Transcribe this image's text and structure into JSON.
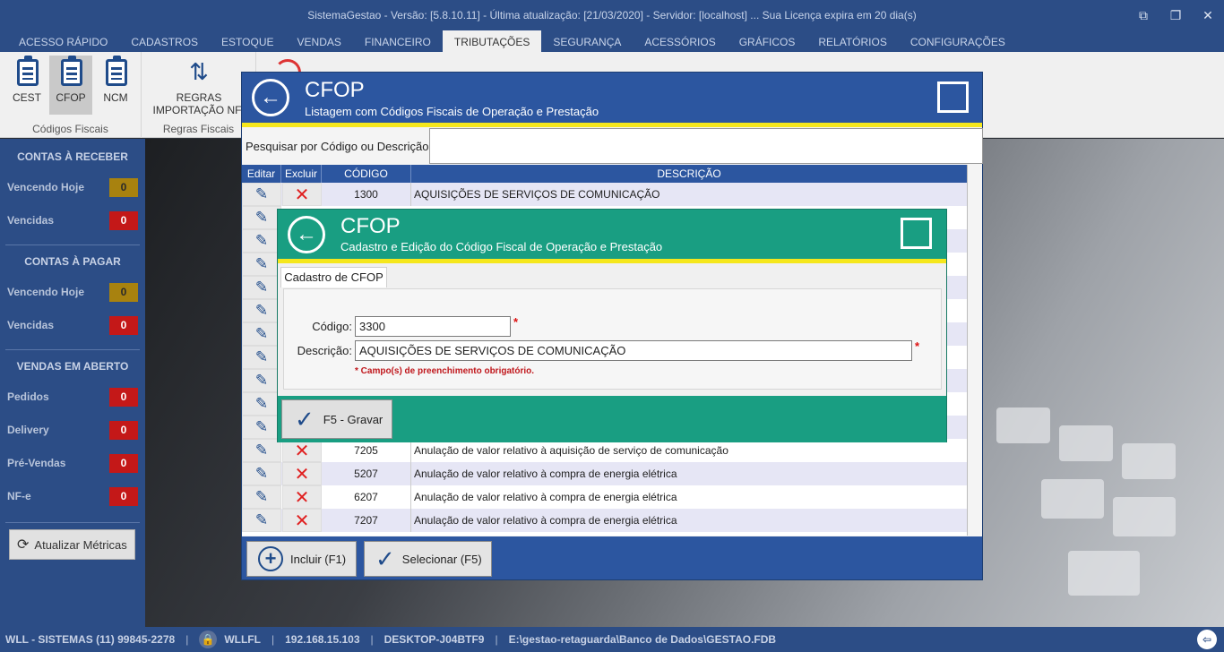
{
  "window": {
    "title": "SistemaGestao - Versão: [5.8.10.11] - Última atualização: [21/03/2020] - Servidor: [localhost] ... Sua Licença expira em 20 dia(s)",
    "controls": [
      "restore-down-icon",
      "maximize-icon",
      "close-icon"
    ]
  },
  "menu": {
    "items": [
      "ACESSO RÁPIDO",
      "CADASTROS",
      "ESTOQUE",
      "VENDAS",
      "FINANCEIRO",
      "TRIBUTAÇÕES",
      "SEGURANÇA",
      "ACESSÓRIOS",
      "GRÁFICOS",
      "RELATÓRIOS",
      "CONFIGURAÇÕES"
    ],
    "active": "TRIBUTAÇÕES"
  },
  "ribbon": {
    "group1": {
      "label": "Códigos Fiscais",
      "buttons": [
        "CEST",
        "CFOP",
        "NCM"
      ],
      "selected": "CFOP"
    },
    "group2": {
      "label": "Regras Fiscais",
      "button_line1": "REGRAS",
      "button_line2": "IMPORTAÇÃO NF-"
    }
  },
  "sidebar": {
    "receber": {
      "title": "CONTAS À RECEBER",
      "hoje_label": "Vencendo Hoje",
      "hoje_value": "0",
      "vencidas_label": "Vencidas",
      "vencidas_value": "0"
    },
    "pagar": {
      "title": "CONTAS À PAGAR",
      "hoje_label": "Vencendo Hoje",
      "hoje_value": "0",
      "vencidas_label": "Vencidas",
      "vencidas_value": "0"
    },
    "vendas": {
      "title": "VENDAS EM ABERTO",
      "pedidos_label": "Pedidos",
      "pedidos_value": "0",
      "delivery_label": "Delivery",
      "delivery_value": "0",
      "prevendas_label": "Pré-Vendas",
      "prevendas_value": "0",
      "nfe_label": "NF-e",
      "nfe_value": "0"
    },
    "refresh_label": "Atualizar Métricas",
    "colors": {
      "yellow_badge": "#a8820f",
      "red_badge": "#c41818"
    }
  },
  "statusbar": {
    "company": "WLL - SISTEMAS (11) 99845-2278",
    "user": "WLLFL",
    "ip": "192.168.15.103",
    "host": "DESKTOP-J04BTF9",
    "db": "E:\\gestao-retaguarda\\Banco de Dados\\GESTAO.FDB"
  },
  "list_dialog": {
    "title": "CFOP",
    "subtitle": "Listagem com Códigos Fiscais de Operação e Prestação",
    "search_label": "Pesquisar por Código ou Descrição:",
    "search_value": "",
    "columns": [
      "Editar",
      "Excluir",
      "CÓDIGO",
      "DESCRIÇÃO"
    ],
    "rows": [
      {
        "code": "1300",
        "desc": "AQUISIÇÕES DE SERVIÇOS DE COMUNICAÇÃO"
      },
      {
        "code": "7205",
        "desc": "Anulação de valor relativo à aquisição de serviço de comunicação"
      },
      {
        "code": "5207",
        "desc": "Anulação de valor relativo à compra de energia elétrica"
      },
      {
        "code": "6207",
        "desc": "Anulação de valor relativo à compra de energia elétrica"
      },
      {
        "code": "7207",
        "desc": "Anulação de valor relativo à compra de energia elétrica"
      }
    ],
    "btn_incluir": "Incluir (F1)",
    "btn_selecionar": "Selecionar (F5)",
    "colors": {
      "header": "#2c56a0",
      "accent": "#f5e71c"
    }
  },
  "edit_dialog": {
    "title": "CFOP",
    "subtitle": "Cadastro e Edição do Código Fiscal de Operação e Prestação",
    "tab": "Cadastro de CFOP",
    "codigo_label": "Código:",
    "codigo_value": "3300",
    "descricao_label": "Descrição:",
    "descricao_value": "AQUISIÇÕES DE SERVIÇOS DE COMUNICAÇÃO",
    "required_mark": "*",
    "required_note": "* Campo(s) de preenchimento obrigatório.",
    "btn_gravar": "F5 - Gravar",
    "colors": {
      "header": "#199e82"
    }
  }
}
